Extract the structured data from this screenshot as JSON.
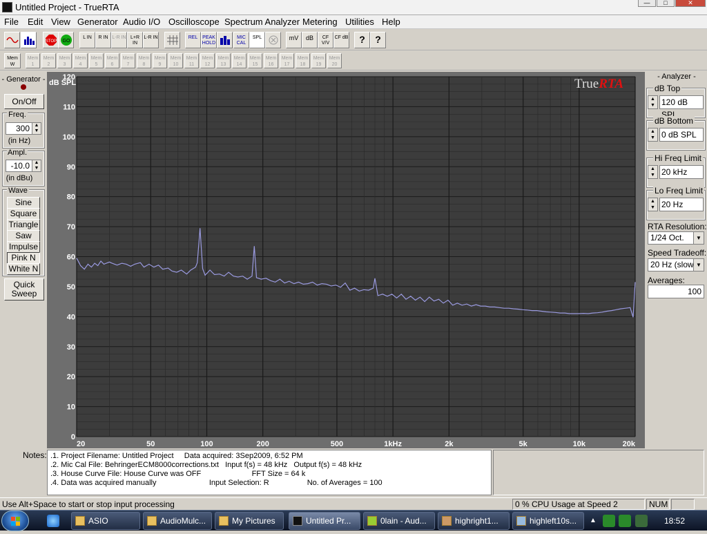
{
  "window": {
    "title": "Untitled Project - TrueRTA"
  },
  "menubar": {
    "items": [
      "File",
      "Edit",
      "View",
      "Generator",
      "Audio I/O",
      "Oscilloscope",
      "Spectrum Analyzer",
      "Metering",
      "Utilities",
      "Help"
    ]
  },
  "toolbar": {
    "buttons": [
      "",
      "",
      "STOP",
      "GO",
      "L IN",
      "R IN",
      "L-R IN",
      "L+R IN",
      "L-R IN",
      "",
      "REL",
      "PEAK HOLD",
      "",
      "MIC CAL",
      "SPL",
      "",
      "mV",
      "dB",
      "CF V/V",
      "CF dB",
      "?",
      "?"
    ]
  },
  "memory_bar": {
    "items": [
      "Mem W",
      "Mem 1",
      "Mem 2",
      "Mem 3",
      "Mem 4",
      "Mem 5",
      "Mem 6",
      "Mem 7",
      "Mem 8",
      "Mem 9",
      "Mem 10",
      "Mem 11",
      "Mem 12",
      "Mem 13",
      "Mem 14",
      "Mem 15",
      "Mem 16",
      "Mem 17",
      "Mem 18",
      "Mem 19",
      "Mem 20"
    ]
  },
  "generator": {
    "title": "- Generator -",
    "onoff_label": "On/Off",
    "freq_label": "Freq.",
    "freq_value": "300",
    "freq_unit": "(in Hz)",
    "ampl_label": "Ampl.",
    "ampl_value": "-10.0",
    "ampl_unit": "(in dBu)",
    "wave_label": "Wave",
    "waves": [
      "Sine",
      "Square",
      "Triangle",
      "Saw",
      "Impulse",
      "Pink N",
      "White N"
    ],
    "selected_wave": "Pink N",
    "quick_sweep_label": "Quick Sweep"
  },
  "analyzer": {
    "title": "- Analyzer -",
    "db_top_label": "dB Top",
    "db_top_value": "120 dB SPL",
    "db_bottom_label": "dB Bottom",
    "db_bottom_value": "0 dB SPL",
    "hi_freq_label": "Hi Freq Limit",
    "hi_freq_value": "20 kHz",
    "lo_freq_label": "Lo Freq Limit",
    "lo_freq_value": "20 Hz",
    "resolution_label": "RTA Resolution:",
    "resolution_value": "1/24 Oct.",
    "speed_label": "Speed Tradeoff:",
    "speed_value": "20 Hz (slow)",
    "averages_label": "Averages:",
    "averages_value": "100"
  },
  "chart_data": {
    "type": "line",
    "title": "",
    "brand": {
      "prefix": "True",
      "suffix": "RTA"
    },
    "ylabel": "dB SPL",
    "xlabel": "",
    "xscale": "log",
    "xlim": [
      20,
      20000
    ],
    "ylim": [
      0,
      120
    ],
    "yticks": [
      "0",
      "10",
      "20",
      "30",
      "40",
      "50",
      "60",
      "70",
      "80",
      "90",
      "100",
      "110",
      "120"
    ],
    "xticks": [
      {
        "value": 20,
        "label": "20"
      },
      {
        "value": 50,
        "label": "50"
      },
      {
        "value": 100,
        "label": "100"
      },
      {
        "value": 200,
        "label": "200"
      },
      {
        "value": 500,
        "label": "500"
      },
      {
        "value": 1000,
        "label": "1kHz"
      },
      {
        "value": 2000,
        "label": "2k"
      },
      {
        "value": 5000,
        "label": "5k"
      },
      {
        "value": 10000,
        "label": "10k"
      },
      {
        "value": 20000,
        "label": "20k"
      }
    ],
    "grid": true,
    "colors": {
      "background": "#3c3c3c",
      "grid_minor": "#2a2a2a",
      "grid_major": "#1a1a1a",
      "line": "#9a9ae0"
    },
    "series": [
      {
        "x": [
          20,
          21,
          22,
          23,
          24,
          25,
          26,
          27,
          28,
          30,
          31,
          33,
          35,
          37,
          39,
          41,
          44,
          46,
          49,
          52,
          55,
          58,
          62,
          65,
          69,
          73,
          78,
          82,
          87,
          89,
          92,
          95,
          98,
          104,
          110,
          117,
          124,
          131,
          139,
          147,
          156,
          165,
          175,
          180,
          185,
          196,
          208,
          220,
          233,
          247,
          262,
          277,
          294,
          311,
          330,
          349,
          370,
          392,
          415,
          440,
          466,
          494,
          523,
          554,
          587,
          622,
          659,
          698,
          740,
          784,
          800,
          830,
          880,
          932,
          988,
          1047,
          1109,
          1175,
          1245,
          1319,
          1397,
          1480,
          1568,
          1661,
          1760,
          1865,
          1976,
          2093,
          2217,
          2349,
          2489,
          2637,
          2794,
          2960,
          3136,
          3322,
          3520,
          3729,
          3951,
          4186,
          4435,
          4699,
          4978,
          5274,
          5588,
          5920,
          6272,
          6645,
          7040,
          7459,
          7902,
          8372,
          8870,
          9397,
          9956,
          10548,
          11175,
          11840,
          12544,
          13290,
          14080,
          14917,
          15804,
          16744,
          17740,
          18795,
          19500,
          20000
        ],
        "y": [
          59.5,
          57,
          55.8,
          57.5,
          56.5,
          57.8,
          57,
          58.5,
          57.5,
          58.2,
          57.8,
          57.2,
          57.8,
          57.5,
          56.8,
          57.5,
          58,
          56.5,
          57.5,
          56.5,
          57.2,
          55.8,
          56.2,
          55.2,
          54.8,
          55.5,
          54.2,
          55.5,
          56.5,
          58,
          69.5,
          56,
          53.8,
          55.5,
          54,
          54.2,
          53.5,
          54.8,
          53.5,
          53.2,
          53.5,
          52.5,
          53.5,
          63.5,
          53,
          52.5,
          52.8,
          52,
          51.5,
          52.5,
          51.2,
          51.8,
          51,
          51.5,
          50.8,
          51,
          51.5,
          50.5,
          51,
          50.8,
          50.2,
          50.5,
          49.8,
          51.2,
          48.8,
          49.5,
          48.5,
          49,
          48.8,
          49.5,
          52.8,
          47,
          47.5,
          46.8,
          47.5,
          46.2,
          47.5,
          45.8,
          46.8,
          45.5,
          46.5,
          45,
          46.5,
          45.2,
          45.8,
          44.5,
          45.5,
          43.8,
          44.5,
          43.8,
          44.2,
          43.5,
          44,
          43.5,
          43.5,
          43.2,
          43.2,
          43,
          42.8,
          42.8,
          42.6,
          42.5,
          42.3,
          42.2,
          42,
          42,
          41.8,
          41.6,
          41.5,
          41.4,
          41.2,
          41.2,
          41,
          41,
          41,
          41.1,
          41,
          41.2,
          41.3,
          41.5,
          41.8,
          42,
          42.3,
          42.6,
          42.8,
          43,
          39.8,
          51.5
        ]
      }
    ]
  },
  "notes": {
    "label": "Notes:",
    "lines": [
      ".1. Project Filename: Untitled Project     Data acquired: 3Sep2009, 6:52 PM",
      ".2. Mic Cal File: BehringerECM8000corrections.txt   Input f(s) = 48 kHz   Output f(s) = 48 kHz",
      ".3. House Curve File: House Curve was OFF                        FFT Size = 64 k",
      ".4. Data was acquired manually                         Input Selection: R                  No. of Averages = 100"
    ]
  },
  "statusbar": {
    "hint": "Use Alt+Space to start or stop input processing",
    "cpu": "0 % CPU Usage at Speed 2",
    "num": "NUM"
  },
  "taskbar": {
    "tasks": [
      "ASIO",
      "AudioMulc...",
      "My Pictures",
      "Untitled Pr...",
      "0lain - Aud...",
      "highright1...",
      "highleft10s..."
    ],
    "active_task": "Untitled Pr...",
    "clock": "18:52"
  }
}
